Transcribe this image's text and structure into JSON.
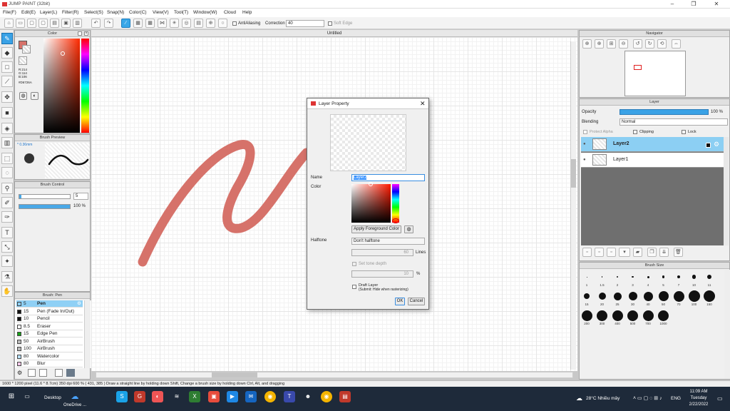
{
  "app": {
    "title": "JUMP PAINT (32bit)"
  },
  "menu": [
    "File(F)",
    "Edit(E)",
    "Layer(L)",
    "Filter(R)",
    "Select(S)",
    "Snap(N)",
    "Color(C)",
    "View(V)",
    "Tool(T)",
    "Window(W)",
    "Cloud",
    "Help"
  ],
  "toolbar": {
    "antialiasing_label": "AntiAliasing",
    "correction_label": "Correction",
    "correction_value": "40",
    "soft_edge_label": "Soft Edge"
  },
  "document": {
    "tab_title": "Untitled"
  },
  "color_panel": {
    "title": "Color",
    "r": "R:214",
    "g": "G:114",
    "b": "B:106",
    "hex": "#D6726A",
    "main_color": "#D6726A"
  },
  "brush_preview": {
    "title": "Brush Preview",
    "size": "* 0.36mm"
  },
  "brush_control": {
    "title": "Brush Control",
    "size_value": "5",
    "opacity_value": "100 %"
  },
  "brush_list": {
    "title": "Brush: Pen",
    "items": [
      {
        "size": "5",
        "name": "Pen",
        "color": "#111111"
      },
      {
        "size": "15",
        "name": "Pen (Fade In/Out)",
        "color": "#111111"
      },
      {
        "size": "10",
        "name": "Pencil",
        "color": "#111111"
      },
      {
        "size": "8.5",
        "name": "Eraser",
        "color": "#ffffff"
      },
      {
        "size": "15",
        "name": "Edge Pen",
        "color": "#19a019"
      },
      {
        "size": "50",
        "name": "AirBrush",
        "color": "#bbbbbb"
      },
      {
        "size": "100",
        "name": "AirBrush",
        "color": "#bbbbbb"
      },
      {
        "size": "80",
        "name": "Watercolor",
        "color": "#b7dff5"
      },
      {
        "size": "80",
        "name": "Blur",
        "color": "#f4c8e8"
      }
    ]
  },
  "navigator": {
    "title": "Navigator"
  },
  "layer_panel": {
    "title": "Layer",
    "opacity_label": "Opacity",
    "opacity_value": "100 %",
    "blending_label": "Blending",
    "blending_value": "Normal",
    "protect_alpha": "Protect Alpha",
    "clipping": "Clipping",
    "lock": "Lock",
    "layers": [
      {
        "name": "Layer2",
        "selected": true
      },
      {
        "name": "Layer1",
        "selected": false
      }
    ]
  },
  "brush_size": {
    "title": "Brush Size",
    "sizes": [
      "1",
      "1.5",
      "2",
      "3",
      "4",
      "5",
      "7",
      "10",
      "11",
      "15",
      "20",
      "25",
      "30",
      "40",
      "50",
      "70",
      "100",
      "150",
      "200",
      "300",
      "400",
      "500",
      "700",
      "1000"
    ]
  },
  "dialog": {
    "title": "Layer Property",
    "name_label": "Name",
    "name_value": "Layer2",
    "color_label": "Color",
    "apply_fg": "Apply Foreground Color",
    "halftone_label": "Halftone",
    "halftone_value": "Don't halftone",
    "lines_value": "60",
    "lines_label": "Lines",
    "tone_depth": "Set tone depth",
    "tone_value": "10",
    "tone_unit": "%",
    "draft_layer": "Draft Layer",
    "draft_sub": "(Submit: Hide when rasterizing)",
    "ok": "OK",
    "cancel": "Cancel"
  },
  "status": {
    "text": "1600 * 1200 pixel   (11.6 * 8.7cm)  350 dpi  600 %  ( 431, 385 )  Draw a straight line by holding down Shift, Change a brush size by holding down Ctrl, Alt, and dragging"
  },
  "taskbar": {
    "desktop": "Desktop",
    "onedrive": "OneDrive ...",
    "weather": "28°C  Nhiều mây",
    "lang": "ENG",
    "time": "11:09 AM",
    "day": "Tuesday",
    "date": "2/22/2022"
  },
  "colors": {
    "accent": "#3aa2e6",
    "stroke": "#D6726A"
  }
}
